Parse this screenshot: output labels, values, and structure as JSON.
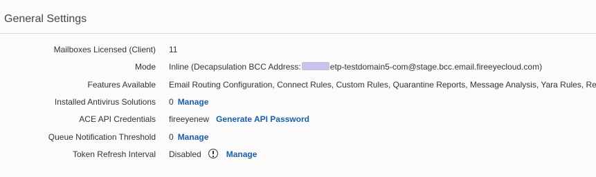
{
  "section": {
    "title": "General Settings"
  },
  "settings": {
    "mailboxes": {
      "label": "Mailboxes Licensed (Client)",
      "value": "11"
    },
    "mode": {
      "label": "Mode",
      "value_prefix": "Inline (Decapsulation BCC Address:",
      "value_suffix": "etp-testdomain5-com@stage.bcc.email.fireeyecloud.com)"
    },
    "features": {
      "label": "Features Available",
      "value": "Email Routing Configuration, Connect Rules, Custom Rules, Quarantine Reports, Message Analysis, Yara Rules, Remediation"
    },
    "antivirus": {
      "label": "Installed Antivirus Solutions",
      "value": "0",
      "action": "Manage"
    },
    "ace_api": {
      "label": "ACE API Credentials",
      "value": "fireeyenew",
      "action": "Generate API Password"
    },
    "queue_threshold": {
      "label": "Queue Notification Threshold",
      "value": "0",
      "action": "Manage"
    },
    "token_refresh": {
      "label": "Token Refresh Interval",
      "value": "Disabled",
      "icon": "info-circle-icon",
      "action": "Manage"
    }
  },
  "colors": {
    "link": "#1a5fa8",
    "text": "#333333",
    "header_border": "#d9d9d9",
    "redaction": "#c9c2e6"
  }
}
